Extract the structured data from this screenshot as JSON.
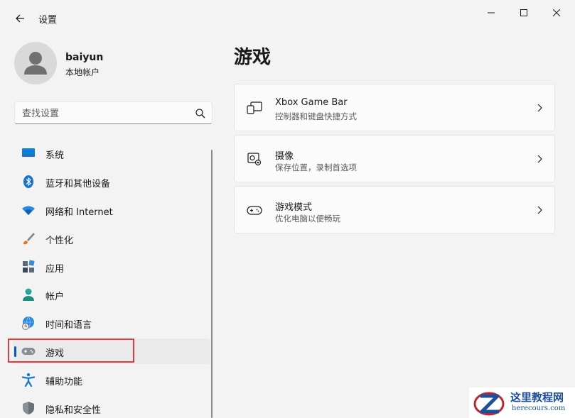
{
  "window": {
    "title": "设置",
    "controls": [
      "minimize",
      "maximize",
      "close"
    ]
  },
  "user": {
    "name": "baiyun",
    "account_type": "本地帐户"
  },
  "search": {
    "placeholder": "查找设置"
  },
  "sidebar": {
    "items": [
      {
        "label": "系统",
        "icon": "monitor-icon"
      },
      {
        "label": "蓝牙和其他设备",
        "icon": "bluetooth-icon"
      },
      {
        "label": "网络和 Internet",
        "icon": "wifi-icon"
      },
      {
        "label": "个性化",
        "icon": "brush-icon"
      },
      {
        "label": "应用",
        "icon": "apps-icon"
      },
      {
        "label": "帐户",
        "icon": "account-icon"
      },
      {
        "label": "时间和语言",
        "icon": "globe-clock-icon"
      },
      {
        "label": "游戏",
        "icon": "gamepad-icon",
        "selected": true
      },
      {
        "label": "辅助功能",
        "icon": "accessibility-icon"
      },
      {
        "label": "隐私和安全性",
        "icon": "shield-icon"
      }
    ]
  },
  "main": {
    "title": "游戏",
    "cards": [
      {
        "title": "Xbox Game Bar",
        "subtitle": "控制器和键盘快捷方式",
        "icon": "game-bar-icon"
      },
      {
        "title": "摄像",
        "subtitle": "保存位置，录制首选项",
        "icon": "capture-icon"
      },
      {
        "title": "游戏模式",
        "subtitle": "优化电脑以便畅玩",
        "icon": "game-mode-icon"
      }
    ]
  },
  "watermark": {
    "text_cn": "这里教程网",
    "text_en": "herecours.com"
  },
  "colors": {
    "accent": "#005fb8",
    "highlight": "#e33b3b",
    "background": "#f3f3f3",
    "card": "#fbfbfb"
  }
}
